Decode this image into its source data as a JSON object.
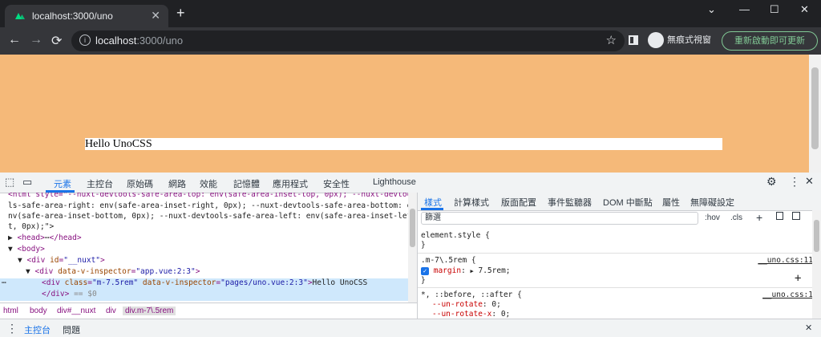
{
  "browser": {
    "tab_title": "localhost:3000/uno",
    "tab_close": "✕",
    "new_tab": "+",
    "window_controls": {
      "chevron": "⌄",
      "minimize": "—",
      "maximize": "☐",
      "close": "✕"
    },
    "nav": {
      "back": "←",
      "forward": "→",
      "reload": "⟳"
    },
    "url_host": "localhost",
    "url_path": ":3000/uno",
    "info_icon": "i",
    "star_icon": "☆",
    "incognito_label": "無痕式視窗",
    "update_label": "重新啟動即可更新",
    "more_icon": "⋮",
    "colors": {
      "titlebar": "#202124",
      "toolbar": "#35363a",
      "update": "#81c995",
      "page_bg": "#f5b979"
    }
  },
  "page": {
    "hello_text": "Hello UnoCSS"
  },
  "devtools": {
    "tabs": [
      "元素",
      "主控台",
      "原始碼",
      "網路",
      "效能",
      "記憶體",
      "應用程式",
      "安全性",
      "Lighthouse"
    ],
    "active_tab": "元素",
    "elements": {
      "line1a": "<html style=\"--nuxt-devtools-safe-area-top: env(safe-area-inset-top, 0px); --nuxt-devtoo",
      "line1b": "ls-safe-area-right: env(safe-area-inset-right, 0px); --nuxt-devtools-safe-area-bottom: e",
      "line1c": "nv(safe-area-inset-bottom, 0px); --nuxt-devtools-safe-area-left: env(safe-area-inset-lef",
      "line1d": "t, 0px);\">",
      "head": "<head>",
      "head_ellipsis": "⋯",
      "head_close": "</head>",
      "body": "<body>",
      "div_nuxt_tag": "<div ",
      "div_nuxt_attr": "id",
      "div_nuxt_val": "\"__nuxt\"",
      "div_app_tag": "<div ",
      "div_app_attr": "data-v-inspector",
      "div_app_val": "\"app.vue:2:3\"",
      "selected_dots": "⋯",
      "div_sel_tag": "<div ",
      "div_sel_attr1": "class",
      "div_sel_val1": "\"m-7.5rem\"",
      "div_sel_attr2": "data-v-inspector",
      "div_sel_val2": "\"pages/uno.vue:2:3\"",
      "div_sel_text": "Hello UnoCSS",
      "div_close": "</div>",
      "div_close_eq": "== $0"
    },
    "breadcrumbs": [
      "html",
      "body",
      "div#__nuxt",
      "div",
      "div.m-7\\.5rem"
    ],
    "styles_tabs": [
      "樣式",
      "計算樣式",
      "版面配置",
      "事件監聽器",
      "DOM 中斷點",
      "屬性",
      "無障礙設定"
    ],
    "filter_placeholder": "篩選",
    "filter_tools": {
      "hov": ":hov",
      "cls": ".cls",
      "plus": "+"
    },
    "element_style": "element.style {",
    "close_brace": "}",
    "rule1_selector": ".m-7\\.5rem {",
    "rule1_source": "__uno.css:11",
    "rule1_prop": "margin",
    "rule1_value": "7.5rem;",
    "check": "✓",
    "add": "+",
    "rule2_selector": "*, ::before, ::after {",
    "rule2_source": "__uno.css:1",
    "rule2_prop1": "--un-rotate",
    "rule2_val1": "0;",
    "rule2_prop2": "--un-rotate-x",
    "rule2_val2": "0;",
    "bottom_tabs": [
      "主控台",
      "問題"
    ],
    "gear_icon": "⚙",
    "more_icon": "⋮",
    "close_icon": "✕",
    "inspect_icon": "⬚",
    "device_icon": "▭",
    "triangle_down": "▼",
    "triangle_right": "▶",
    "colors": {
      "accent": "#1a73e8",
      "tag": "#881280",
      "attr": "#994500",
      "value": "#1a1aa6",
      "selected": "#cfe8fc"
    }
  }
}
